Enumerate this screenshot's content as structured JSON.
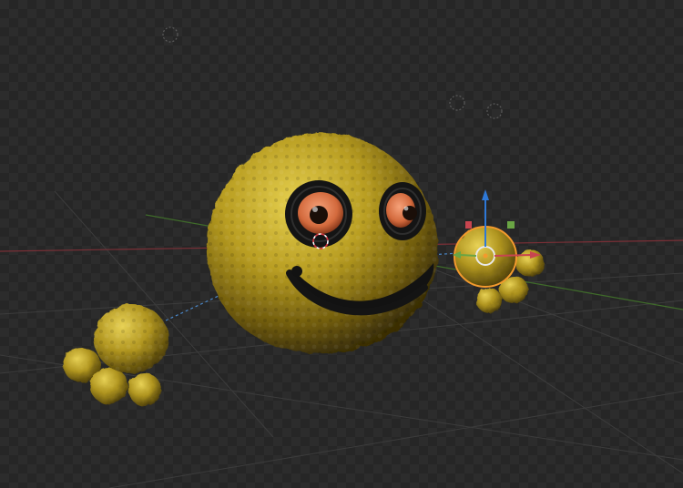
{
  "viewport": {
    "name": "3D Viewport",
    "checker_colors": [
      "#2c2c2c",
      "#262626"
    ]
  },
  "colors": {
    "x_axis": "#c8454f",
    "y_axis": "#6aa544",
    "z_axis": "#2e78d6",
    "selection": "#f39a2d",
    "body_gold": "#b29a22",
    "eye_iris": "#e07a4a"
  },
  "scene": {
    "objects": [
      {
        "name": "smiley-head",
        "icon": "head-mesh",
        "selected": false
      },
      {
        "name": "left-paw",
        "icon": "paw-mesh",
        "selected": false
      },
      {
        "name": "right-paw",
        "icon": "paw-mesh",
        "selected": true
      }
    ],
    "gizmo": {
      "icon": "move-gizmo",
      "axes": [
        "x",
        "y",
        "z"
      ]
    }
  }
}
